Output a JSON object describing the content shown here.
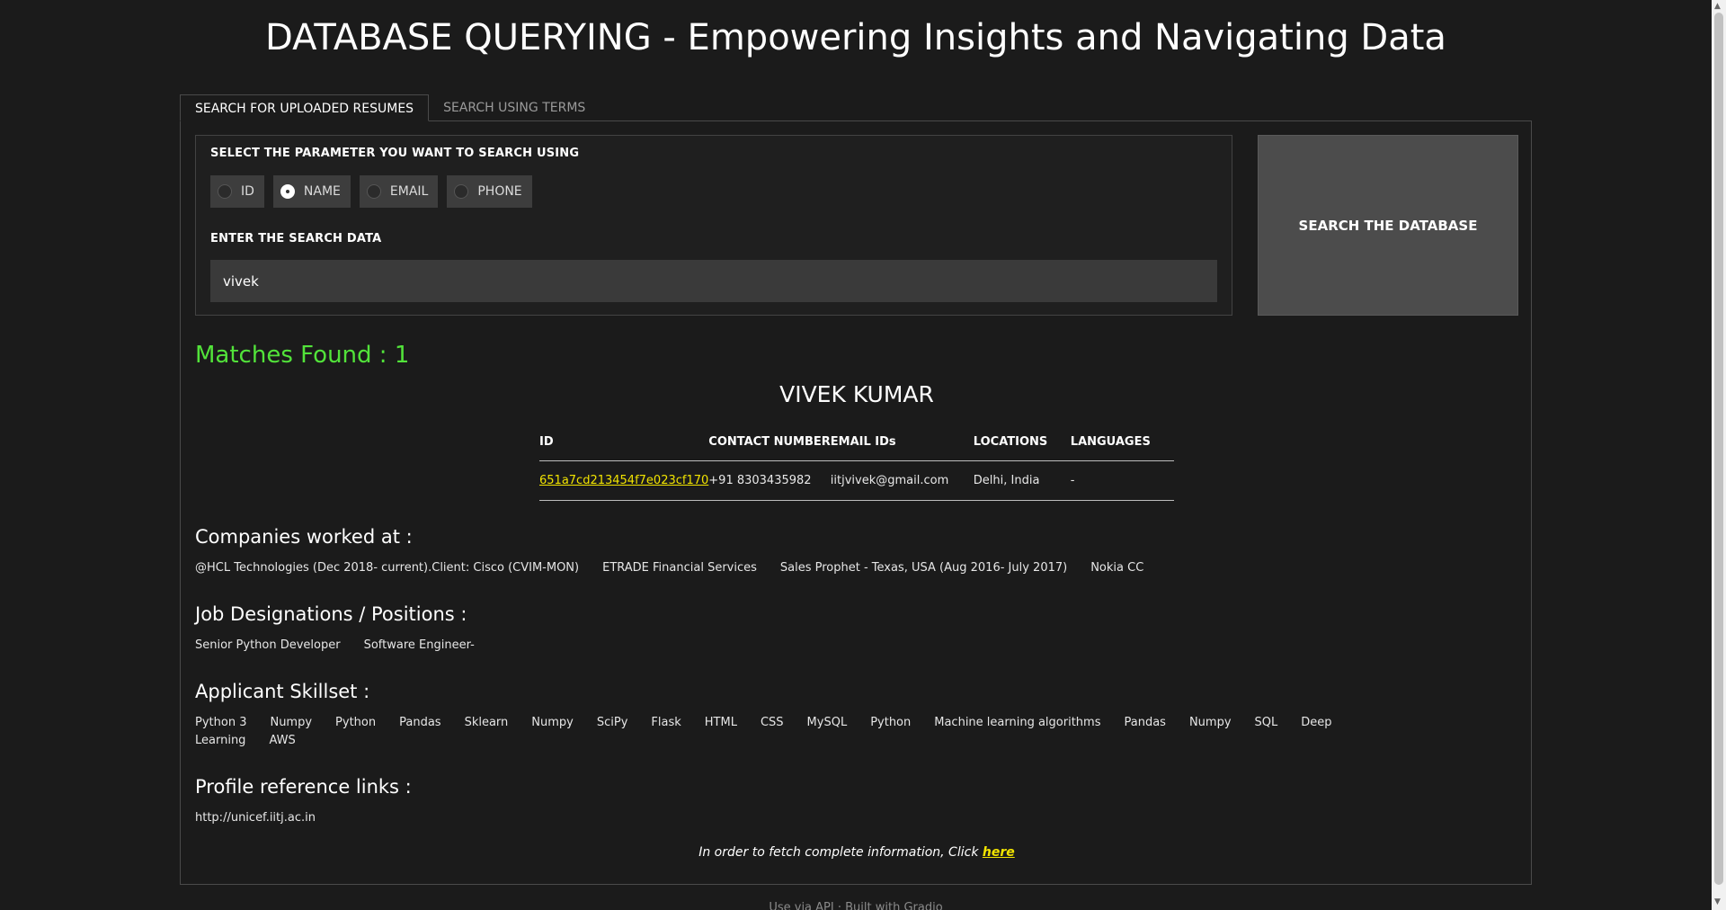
{
  "header": {
    "title": "DATABASE QUERYING - Empowering Insights and Navigating Data"
  },
  "tabs": [
    {
      "label": "SEARCH FOR UPLOADED RESUMES",
      "active": true
    },
    {
      "label": "SEARCH USING TERMS",
      "active": false
    }
  ],
  "search": {
    "param_label": "SELECT THE PARAMETER YOU WANT TO SEARCH USING",
    "options": [
      "ID",
      "NAME",
      "EMAIL",
      "PHONE"
    ],
    "selected": "NAME",
    "data_label": "ENTER THE SEARCH DATA",
    "value": "vivek",
    "button_label": "SEARCH THE DATABASE"
  },
  "results": {
    "matches": "Matches Found : 1",
    "name": "VIVEK KUMAR",
    "columns": [
      "ID",
      "CONTACT NUMBER",
      "EMAIL IDs",
      "LOCATIONS",
      "LANGUAGES"
    ],
    "row": {
      "id": "651a7cd213454f7e023cf170",
      "phone": "+91 8303435982",
      "email": "iitjvivek@gmail.com",
      "location": "Delhi, India",
      "languages": "-"
    },
    "companies_title": "Companies worked at :",
    "companies": [
      "@HCL Technologies (Dec 2018- current).Client: Cisco (CVIM-MON)",
      "ETRADE Financial Services",
      "Sales Prophet - Texas, USA (Aug 2016- July 2017)",
      "Nokia CC"
    ],
    "positions_title": "Job Designations / Positions :",
    "positions": [
      "Senior Python Developer",
      "Software Engineer-"
    ],
    "skills_title": "Applicant Skillset :",
    "skills": [
      "Python 3",
      "Numpy",
      "Python",
      "Pandas",
      "Sklearn",
      "Numpy",
      "SciPy",
      "Flask",
      "HTML",
      "CSS",
      "MySQL",
      "Python",
      "Machine learning algorithms",
      "Pandas",
      "Numpy",
      "SQL",
      "Deep Learning",
      "AWS"
    ],
    "links_title": "Profile reference links :",
    "links": [
      "http://unicef.iitj.ac.in"
    ],
    "note_text": "In order to fetch complete information, Click ",
    "note_link": "here"
  },
  "footer": {
    "api": "Use via API",
    "built": "Built with Gradio"
  },
  "colors": {
    "background": "#1b1b1b",
    "matches": "#52e33a",
    "link": "#f2e400"
  }
}
